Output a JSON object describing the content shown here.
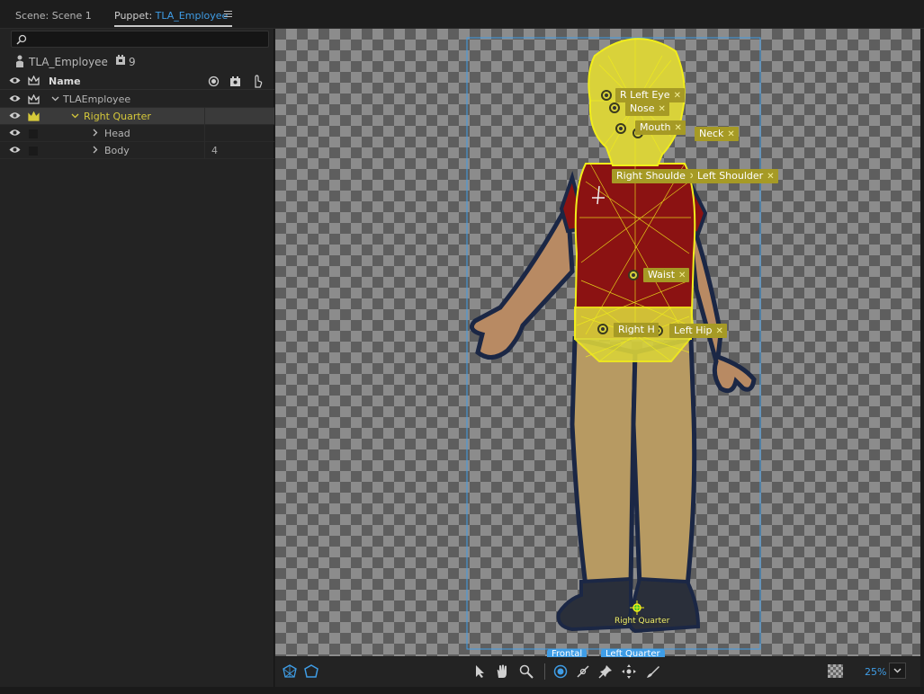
{
  "tabs": {
    "scene": "Scene: Scene 1",
    "puppet_prefix": "Puppet: ",
    "puppet_name": "TLA_Employee"
  },
  "puppet_panel": {
    "search_placeholder": "",
    "puppet_name": "TLA_Employee",
    "layer_count": "9",
    "column_name": "Name",
    "rows": [
      {
        "label": "TLAEmployee",
        "count": ""
      },
      {
        "label": "Right Quarter",
        "count": ""
      },
      {
        "label": "Head",
        "count": ""
      },
      {
        "label": "Body",
        "count": "4"
      }
    ]
  },
  "handles": [
    {
      "label": "Right Eye",
      "shown": "Ri    Left Eye"
    },
    {
      "label": "Left Eye"
    },
    {
      "label": "Nose"
    },
    {
      "label": "Mouth"
    },
    {
      "label": "Neck"
    },
    {
      "label": "Right Shoulder"
    },
    {
      "label": "Left Shoulder"
    },
    {
      "label": "Waist"
    },
    {
      "label": "Right Hip"
    },
    {
      "label": "Left Hip"
    }
  ],
  "tags": {
    "eyes": "R    Left Eye",
    "nose": "Nose",
    "mouth": "Mouth",
    "neck": "Neck",
    "right_shoulder": "Right Shoulde",
    "left_shoulder": "Left Shoulder",
    "waist": "Waist",
    "right_hip": "Right H",
    "left_hip": "Left Hip",
    "origin": "Right Quarter"
  },
  "view_tabs": [
    "Frontal",
    "Left Quarter"
  ],
  "toolbar": {
    "zoom": "25%"
  },
  "colors": {
    "accent": "#3f9de6",
    "handle": "#a69a25",
    "mesh": "#f2ee1a",
    "shirt": "#8b1212",
    "skin": "#b88a63",
    "pants": "#b79a62"
  }
}
